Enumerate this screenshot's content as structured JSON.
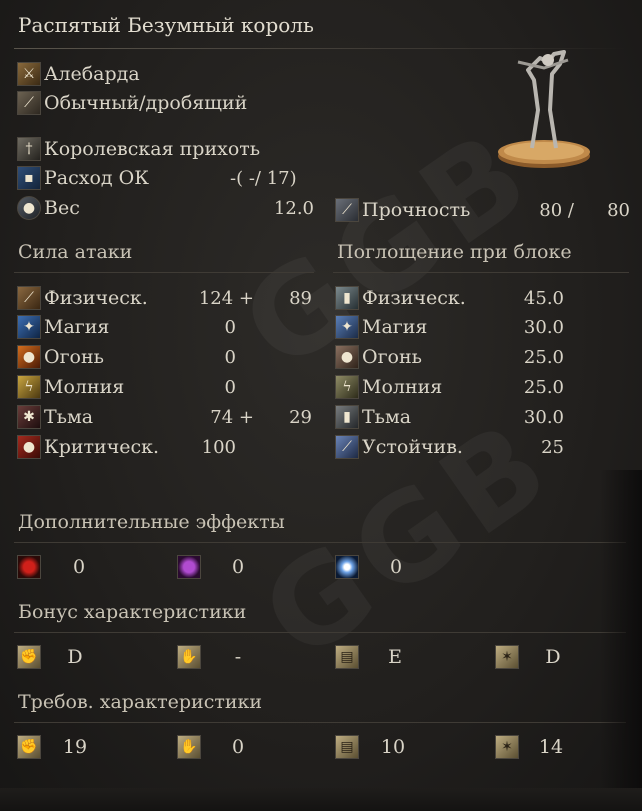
{
  "item": {
    "name": "Распятый Безумный король",
    "type": "Алебарда",
    "attack_type": "Обычный/дробящий",
    "skill": "Королевская прихоть",
    "fp_label": "Расход ОК",
    "fp_value": "-(    -/ 17)",
    "weight_label": "Вес",
    "weight_value": "12.0",
    "durability_label": "Прочность",
    "durability_current": "80 /",
    "durability_max": "80"
  },
  "attack": {
    "title": "Сила атаки",
    "rows": [
      {
        "label": "Физическ.",
        "base": "124 +",
        "bonus": "89",
        "icon": "physical-attack-icon"
      },
      {
        "label": "Магия",
        "base": "0",
        "bonus": "",
        "icon": "magic-attack-icon"
      },
      {
        "label": "Огонь",
        "base": "0",
        "bonus": "",
        "icon": "fire-attack-icon"
      },
      {
        "label": "Молния",
        "base": "0",
        "bonus": "",
        "icon": "lightning-attack-icon"
      },
      {
        "label": "Тьма",
        "base": "74 +",
        "bonus": "29",
        "icon": "dark-attack-icon"
      },
      {
        "label": "Критическ.",
        "base": "100",
        "bonus": "",
        "icon": "critical-icon"
      }
    ]
  },
  "guard": {
    "title": "Поглощение при блоке",
    "rows": [
      {
        "label": "Физическ.",
        "value": "45.0",
        "icon": "physical-guard-icon"
      },
      {
        "label": "Магия",
        "value": "30.0",
        "icon": "magic-guard-icon"
      },
      {
        "label": "Огонь",
        "value": "25.0",
        "icon": "fire-guard-icon"
      },
      {
        "label": "Молния",
        "value": "25.0",
        "icon": "lightning-guard-icon"
      },
      {
        "label": "Тьма",
        "value": "30.0",
        "icon": "dark-guard-icon"
      },
      {
        "label": "Устойчив.",
        "value": "25",
        "icon": "stability-icon"
      }
    ]
  },
  "effects": {
    "title": "Дополнительные эффекты",
    "items": [
      {
        "value": "0",
        "icon": "bleed-icon"
      },
      {
        "value": "0",
        "icon": "poison-icon"
      },
      {
        "value": "0",
        "icon": "frost-icon"
      }
    ]
  },
  "scaling": {
    "title": "Бонус характеристики",
    "items": [
      {
        "value": "D",
        "icon": "strength-icon"
      },
      {
        "value": "-",
        "icon": "dexterity-icon"
      },
      {
        "value": "E",
        "icon": "intelligence-icon"
      },
      {
        "value": "D",
        "icon": "faith-icon"
      }
    ]
  },
  "requirements": {
    "title": "Требов. характеристики",
    "items": [
      {
        "value": "19",
        "icon": "strength-icon"
      },
      {
        "value": "0",
        "icon": "dexterity-icon"
      },
      {
        "value": "10",
        "icon": "intelligence-icon"
      },
      {
        "value": "14",
        "icon": "faith-icon"
      }
    ]
  },
  "watermark": "GGB"
}
